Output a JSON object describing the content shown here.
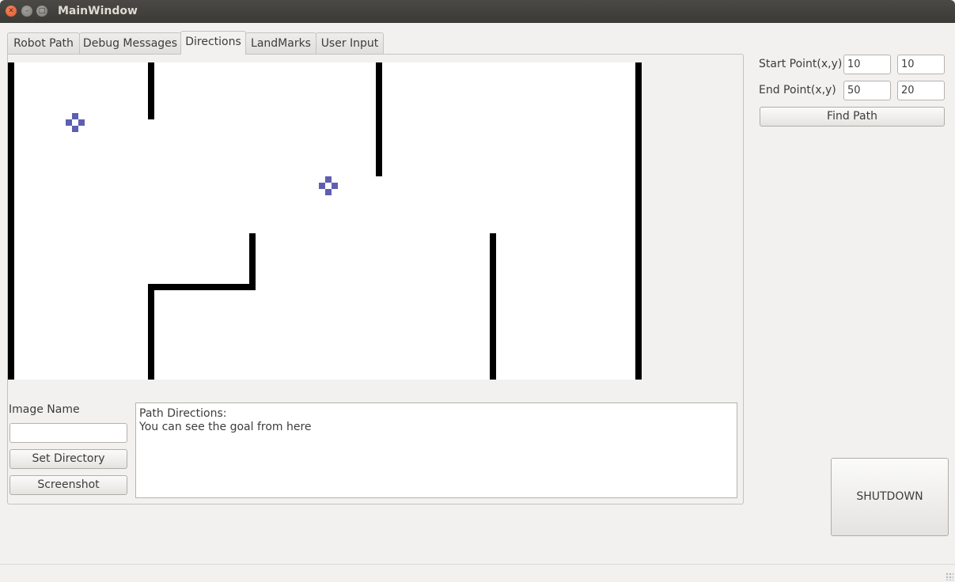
{
  "window": {
    "title": "MainWindow"
  },
  "tabs": [
    {
      "label": "Robot Path"
    },
    {
      "label": "Debug Messages"
    },
    {
      "label": "Directions",
      "active": true
    },
    {
      "label": "LandMarks"
    },
    {
      "label": "User Input"
    }
  ],
  "map": {
    "marker_color": "#5e5fb3",
    "wall_color": "#000000"
  },
  "image_panel": {
    "label": "Image Name",
    "image_name_value": "",
    "set_directory_label": "Set Directory",
    "screenshot_label": "Screenshot"
  },
  "directions": {
    "text": "Path Directions:\nYou can see the goal from here"
  },
  "path_form": {
    "start_label": "Start Point(x,y)",
    "start_x": "10",
    "start_y": "10",
    "end_label": "End Point(x,y)",
    "end_x": "50",
    "end_y": "20",
    "find_path_label": "Find Path"
  },
  "shutdown_label": "SHUTDOWN",
  "colors": {
    "titlebar": "#3c3b37",
    "background": "#f2f1f0",
    "close_button": "#e2542a"
  }
}
